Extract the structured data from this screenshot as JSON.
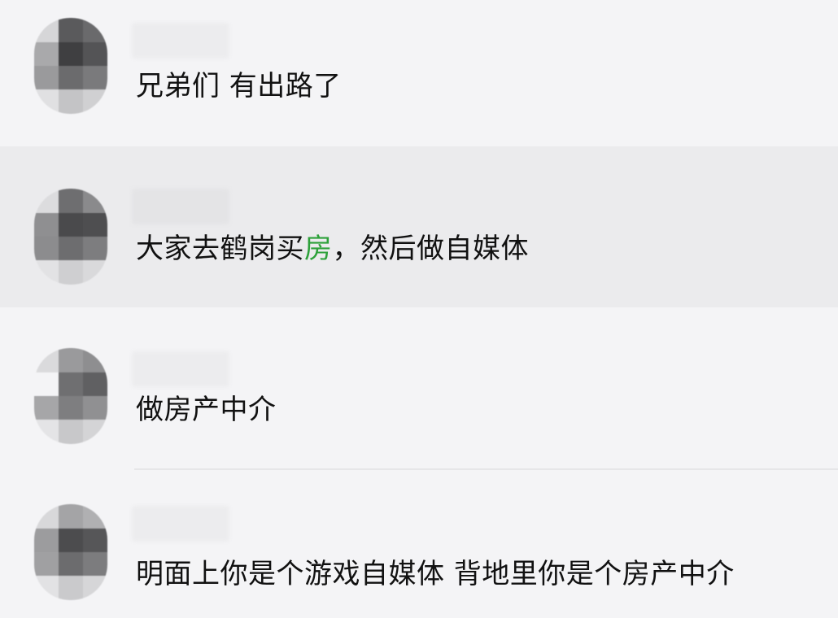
{
  "comments": [
    {
      "text": "兄弟们 有出路了"
    },
    {
      "text_before": "大家去鹤岗买",
      "text_highlight": "房",
      "text_after": "，然后做自媒体",
      "highlight_color": "#2da13a"
    },
    {
      "text": "做房产中介"
    },
    {
      "text": "明面上你是个游戏自媒体 背地里你是个房产中介"
    }
  ]
}
